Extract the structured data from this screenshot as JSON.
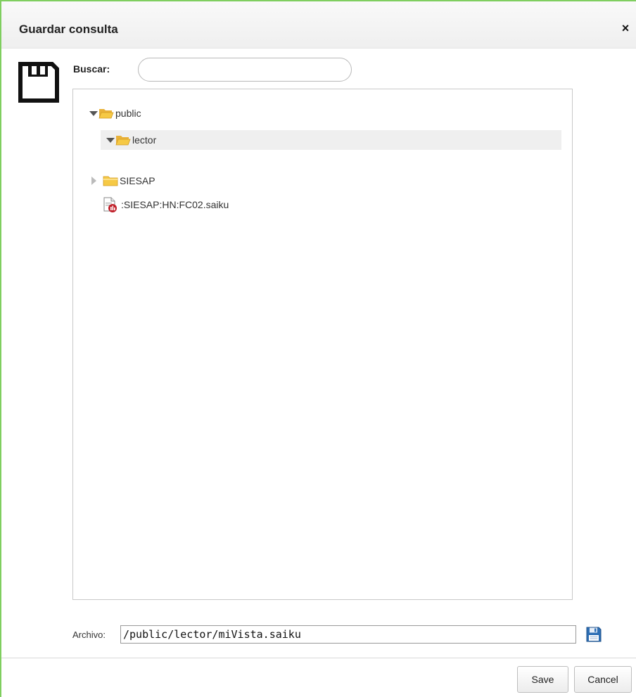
{
  "dialog": {
    "title": "Guardar consulta",
    "close_symbol": "×",
    "colors": {
      "frame_accent": "#7fce5f",
      "folder": "#f6c945",
      "save_icon_blue": "#2e6fb5",
      "file_badge": "#c0202a"
    }
  },
  "search": {
    "label": "Buscar:",
    "value": "",
    "placeholder": ""
  },
  "tree": {
    "nodes": [
      {
        "label": "public",
        "type": "folder",
        "state": "expanded",
        "icon": "folder-open-icon"
      },
      {
        "label": "lector",
        "type": "folder",
        "state": "expanded",
        "selected": true,
        "icon": "folder-open-icon"
      },
      {
        "label": "SIESAP",
        "type": "folder",
        "state": "collapsed",
        "icon": "folder-icon"
      },
      {
        "label": ":SIESAP:HN:FC02.saiku",
        "type": "file",
        "icon": "saiku-file-icon"
      }
    ]
  },
  "archivo": {
    "label": "Archivo:",
    "value": "/public/lector/miVista.saiku"
  },
  "buttons": {
    "save": "Save",
    "cancel": "Cancel"
  }
}
